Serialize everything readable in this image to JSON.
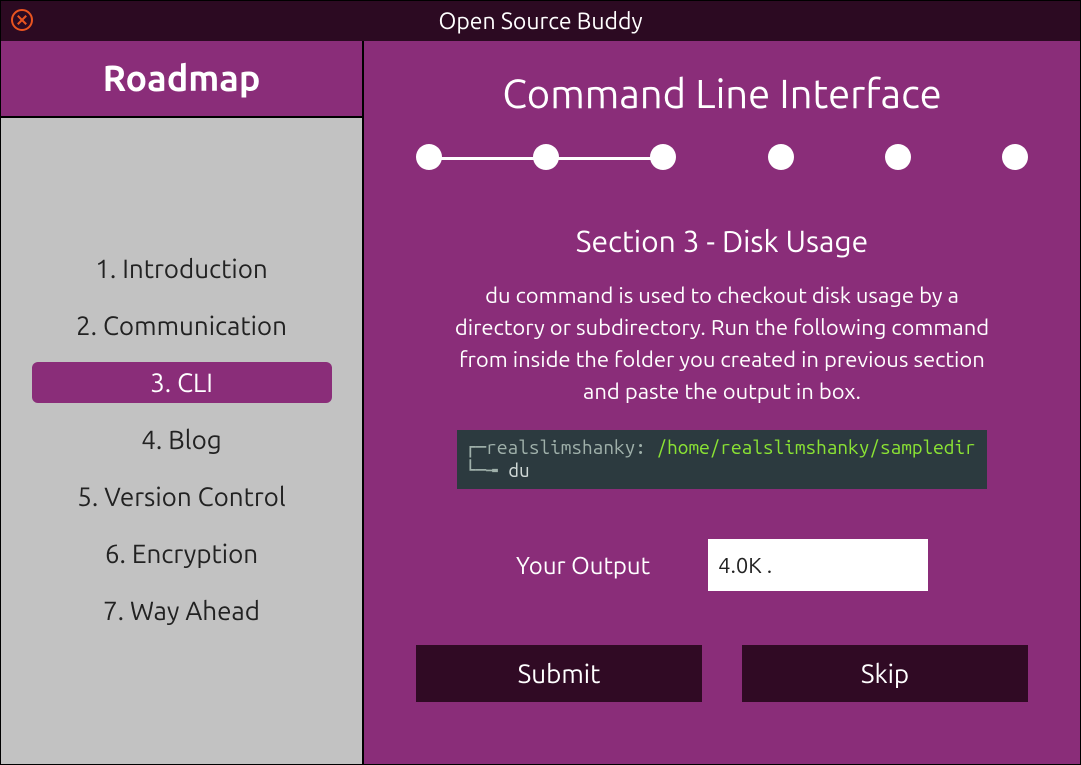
{
  "window": {
    "title": "Open Source Buddy"
  },
  "sidebar": {
    "header": "Roadmap",
    "items": [
      {
        "label": "1. Introduction",
        "active": false
      },
      {
        "label": "2. Communication",
        "active": false
      },
      {
        "label": "3. CLI",
        "active": true
      },
      {
        "label": "4. Blog",
        "active": false
      },
      {
        "label": "5. Version Control",
        "active": false
      },
      {
        "label": "6. Encryption",
        "active": false
      },
      {
        "label": "7. Way Ahead",
        "active": false
      }
    ]
  },
  "main": {
    "title": "Command Line Interface",
    "steps_total": 6,
    "steps_line_between": 2,
    "section_title": "Section 3 - Disk Usage",
    "description": "du command is used to checkout disk usage by a directory or subdirectory. Run the following command from inside the folder you created in previous section and paste the output in box.",
    "terminal": {
      "prompt_user": "realslimshanky:",
      "prompt_path": "/home/realslimshanky/sampledir",
      "command": "du"
    },
    "output_label": "Your Output",
    "output_value": "4.0K .",
    "submit_label": "Submit",
    "skip_label": "Skip"
  }
}
